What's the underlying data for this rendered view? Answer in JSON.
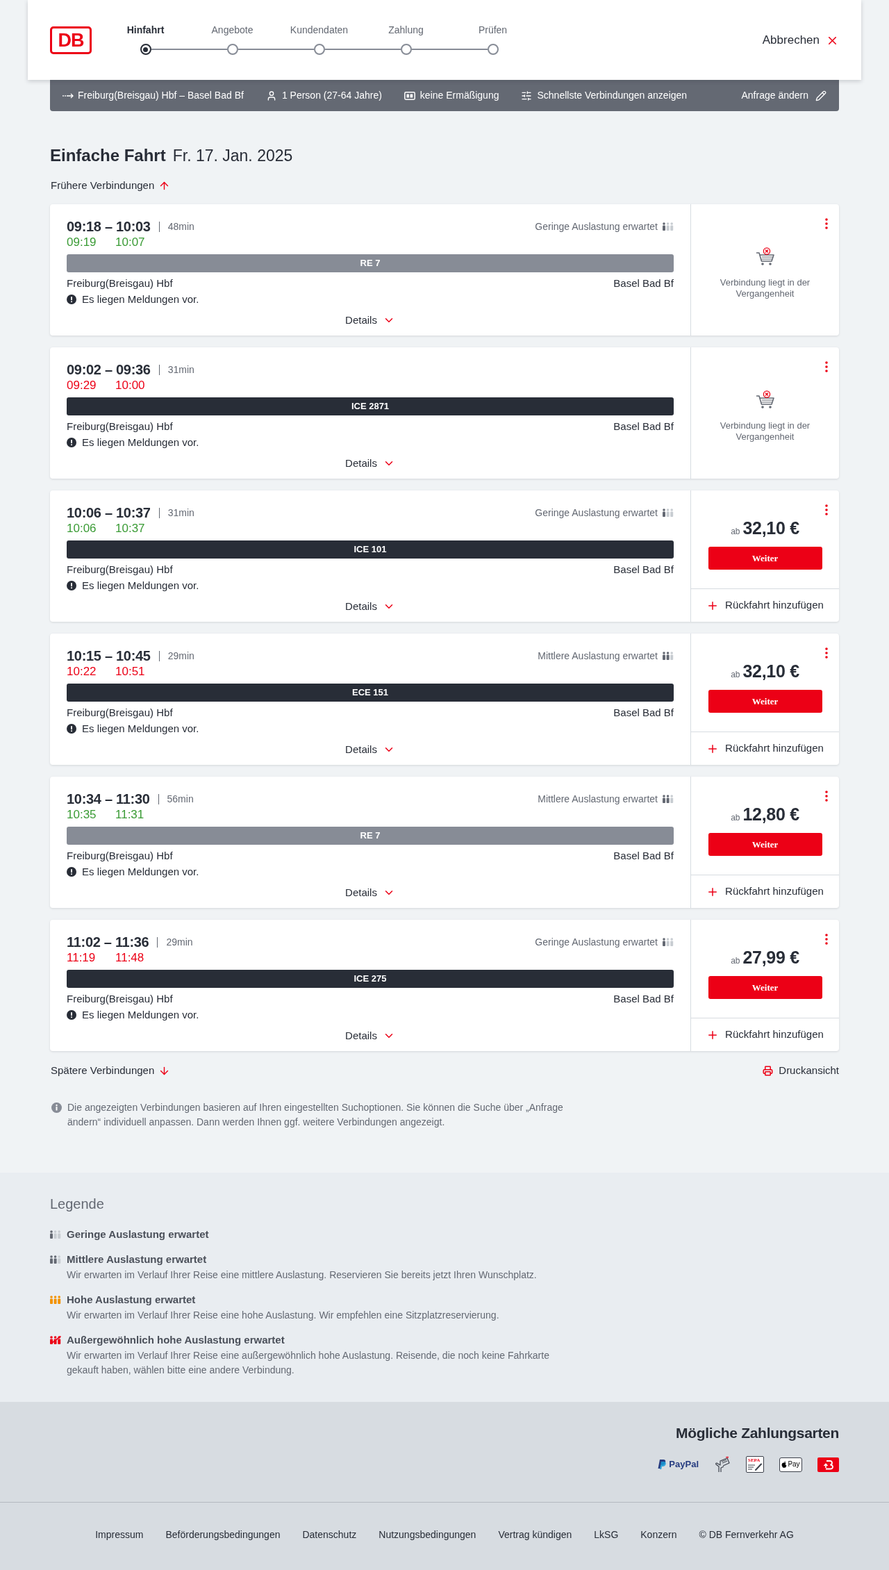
{
  "header": {
    "logo": "DB",
    "steps": [
      {
        "label": "Hinfahrt",
        "selected": true
      },
      {
        "label": "Angebote",
        "selected": false
      },
      {
        "label": "Kundendaten",
        "selected": false
      },
      {
        "label": "Zahlung",
        "selected": false
      },
      {
        "label": "Prüfen",
        "selected": false
      }
    ],
    "cancel": "Abbrechen"
  },
  "search_summary": {
    "route": "Freiburg(Breisgau) Hbf – Basel Bad Bf",
    "passengers": "1 Person (27-64 Jahre)",
    "discount": "keine Ermäßigung",
    "filter": "Schnellste Verbindungen anzeigen",
    "edit": "Anfrage ändern"
  },
  "heading": {
    "trip_type": "Einfache Fahrt",
    "date": "Fr. 17. Jan. 2025"
  },
  "earlier_link": "Frühere Verbindungen",
  "connections": [
    {
      "times": "09:18 – 10:03",
      "duration": "48min",
      "occupancy": {
        "kind": "low",
        "label": "Geringe Auslastung erwartet"
      },
      "realtime": {
        "departure": "09:19",
        "arrival": "10:07",
        "delayed": false
      },
      "train": {
        "name": "RE 7",
        "kind": "regional"
      },
      "from": "Freiburg(Breisgau) Hbf",
      "to": "Basel Bad Bf",
      "message": "Es liegen Meldungen vor.",
      "details": "Details",
      "booking": {
        "kind": "past",
        "notice": "Verbindung liegt in der Vergangenheit"
      }
    },
    {
      "times": "09:02 – 09:36",
      "duration": "31min",
      "realtime": {
        "departure": "09:29",
        "arrival": "10:00",
        "delayed": true
      },
      "train": {
        "name": "ICE 2871",
        "kind": "long_distance"
      },
      "from": "Freiburg(Breisgau) Hbf",
      "to": "Basel Bad Bf",
      "message": "Es liegen Meldungen vor.",
      "details": "Details",
      "booking": {
        "kind": "past",
        "notice": "Verbindung liegt in der Vergangenheit"
      }
    },
    {
      "times": "10:06 – 10:37",
      "duration": "31min",
      "occupancy": {
        "kind": "low",
        "label": "Geringe Auslastung erwartet"
      },
      "realtime": {
        "departure": "10:06",
        "arrival": "10:37",
        "delayed": false
      },
      "train": {
        "name": "ICE 101",
        "kind": "long_distance"
      },
      "from": "Freiburg(Breisgau) Hbf",
      "to": "Basel Bad Bf",
      "message": "Es liegen Meldungen vor.",
      "details": "Details",
      "booking": {
        "kind": "offer",
        "price_prefix": "ab",
        "price": "32,10 €",
        "button": "Weiter",
        "return_trip": "Rückfahrt hinzufügen"
      }
    },
    {
      "times": "10:15 – 10:45",
      "duration": "29min",
      "occupancy": {
        "kind": "medium",
        "label": "Mittlere Auslastung erwartet"
      },
      "realtime": {
        "departure": "10:22",
        "arrival": "10:51",
        "delayed": true
      },
      "train": {
        "name": "ECE 151",
        "kind": "long_distance"
      },
      "from": "Freiburg(Breisgau) Hbf",
      "to": "Basel Bad Bf",
      "message": "Es liegen Meldungen vor.",
      "details": "Details",
      "booking": {
        "kind": "offer",
        "price_prefix": "ab",
        "price": "32,10 €",
        "button": "Weiter",
        "return_trip": "Rückfahrt hinzufügen"
      }
    },
    {
      "times": "10:34 – 11:30",
      "duration": "56min",
      "occupancy": {
        "kind": "medium",
        "label": "Mittlere Auslastung erwartet"
      },
      "realtime": {
        "departure": "10:35",
        "arrival": "11:31",
        "delayed": false
      },
      "train": {
        "name": "RE 7",
        "kind": "regional"
      },
      "from": "Freiburg(Breisgau) Hbf",
      "to": "Basel Bad Bf",
      "message": "Es liegen Meldungen vor.",
      "details": "Details",
      "booking": {
        "kind": "offer",
        "price_prefix": "ab",
        "price": "12,80 €",
        "button": "Weiter",
        "return_trip": "Rückfahrt hinzufügen"
      }
    },
    {
      "times": "11:02 – 11:36",
      "duration": "29min",
      "occupancy": {
        "kind": "low",
        "label": "Geringe Auslastung erwartet"
      },
      "realtime": {
        "departure": "11:19",
        "arrival": "11:48",
        "delayed": true
      },
      "train": {
        "name": "ICE 275",
        "kind": "long_distance"
      },
      "from": "Freiburg(Breisgau) Hbf",
      "to": "Basel Bad Bf",
      "message": "Es liegen Meldungen vor.",
      "details": "Details",
      "booking": {
        "kind": "offer",
        "price_prefix": "ab",
        "price": "27,99 €",
        "button": "Weiter",
        "return_trip": "Rückfahrt hinzufügen"
      }
    }
  ],
  "later_link": "Spätere Verbindungen",
  "print_link": "Druckansicht",
  "info_note": "Die angezeigten Verbindungen basieren auf Ihren eingestellten Suchoptionen. Sie können die Suche über „Anfrage ändern“ individuell anpassen. Dann werden Ihnen ggf. weitere Verbindungen angezeigt.",
  "legend": {
    "title": "Legende",
    "items": [
      {
        "kind": "low",
        "title": "Geringe Auslastung erwartet"
      },
      {
        "kind": "medium",
        "title": "Mittlere Auslastung erwartet",
        "text": "Wir erwarten im Verlauf Ihrer Reise eine mittlere Auslastung. Reservieren Sie bereits jetzt Ihren Wunschplatz."
      },
      {
        "kind": "high",
        "title": "Hohe Auslastung erwartet",
        "text": "Wir erwarten im Verlauf Ihrer Reise eine hohe Auslastung. Wir empfehlen eine Sitzplatzreservierung."
      },
      {
        "kind": "very_high",
        "title": "Außergewöhnlich hohe Auslastung erwartet",
        "text": "Wir erwarten im Verlauf Ihrer Reise eine außergewöhnlich hohe Auslastung. Reisende, die noch keine Fahrkarte gekauft haben, wählen bitte eine andere Verbindung."
      }
    ]
  },
  "payment": {
    "title": "Mögliche Zahlungsarten",
    "methods": [
      {
        "kind": "paypal",
        "label": "PayPal"
      },
      {
        "kind": "contactless_card"
      },
      {
        "kind": "sepa",
        "label": "SEPA"
      },
      {
        "kind": "apple_pay",
        "label": "Pay"
      },
      {
        "kind": "bonus"
      }
    ]
  },
  "footer": {
    "links": [
      "Impressum",
      "Beförderungsbedingungen",
      "Datenschutz",
      "Nutzungsbedingungen",
      "Vertrag kündigen",
      "LkSG",
      "Konzern"
    ],
    "copyright": "© DB Fernverkehr AG"
  }
}
